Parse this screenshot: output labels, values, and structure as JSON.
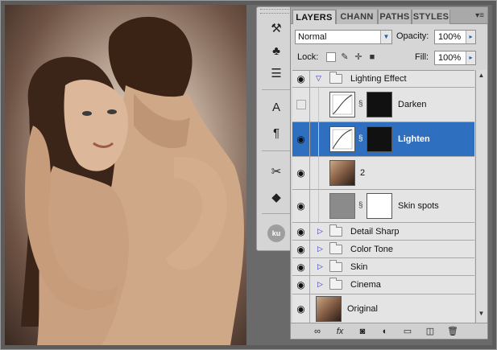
{
  "panel": {
    "tabs": [
      "LAYERS",
      "CHANN",
      "PATHS",
      "STYLES"
    ],
    "menu_icon": "panel-menu-icon",
    "blend_mode": "Normal",
    "opacity_label": "Opacity:",
    "opacity_value": "100%",
    "lock_label": "Lock:",
    "fill_label": "Fill:",
    "fill_value": "100%"
  },
  "layers": [
    {
      "name": "Lighting Effect",
      "type": "group",
      "expanded": true,
      "visible": true
    },
    {
      "name": "Darken",
      "type": "adjustment",
      "visible": false,
      "selected": false
    },
    {
      "name": "Lighten",
      "type": "adjustment",
      "visible": true,
      "selected": true
    },
    {
      "name": "2",
      "type": "image",
      "visible": true
    },
    {
      "name": "Skin spots",
      "type": "masked",
      "visible": true
    },
    {
      "name": "Detail Sharp",
      "type": "group",
      "expanded": false,
      "visible": true
    },
    {
      "name": "Color Tone",
      "type": "group",
      "expanded": false,
      "visible": true
    },
    {
      "name": "Skin",
      "type": "group",
      "expanded": false,
      "visible": true
    },
    {
      "name": "Cinema",
      "type": "group",
      "expanded": false,
      "visible": true
    },
    {
      "name": "Original",
      "type": "image",
      "visible": true
    }
  ],
  "toolbar": {
    "badge": "ku",
    "icons": [
      "move-icon",
      "brush-icon",
      "stamp-icon",
      "type-icon",
      "paragraph-icon",
      "tools-icon",
      "3d-icon"
    ]
  },
  "bottom_icons": [
    "link-icon",
    "fx-icon",
    "mask-icon",
    "adjustment-icon",
    "group-icon",
    "new-layer-icon",
    "trash-icon"
  ],
  "colors": {
    "selection": "#2f6fbf",
    "panel": "#d6d6d6",
    "workspace": "#6a6a6a"
  }
}
